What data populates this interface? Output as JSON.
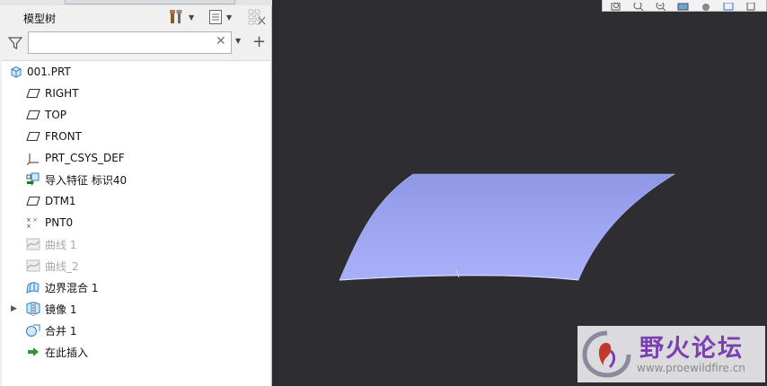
{
  "model_tree": {
    "title": "模型树",
    "search": {
      "value": "",
      "placeholder": ""
    },
    "items": [
      {
        "label": "001.PRT",
        "icon": "part-icon",
        "dim": false,
        "expandable": false,
        "indent": 0
      },
      {
        "label": "RIGHT",
        "icon": "datum-plane-icon",
        "dim": false,
        "expandable": false,
        "indent": 1
      },
      {
        "label": "TOP",
        "icon": "datum-plane-icon",
        "dim": false,
        "expandable": false,
        "indent": 1
      },
      {
        "label": "FRONT",
        "icon": "datum-plane-icon",
        "dim": false,
        "expandable": false,
        "indent": 1
      },
      {
        "label": "PRT_CSYS_DEF",
        "icon": "csys-icon",
        "dim": false,
        "expandable": false,
        "indent": 1
      },
      {
        "label": "导入特征 标识40",
        "icon": "import-feature-icon",
        "dim": false,
        "expandable": false,
        "indent": 1
      },
      {
        "label": "DTM1",
        "icon": "datum-plane-icon",
        "dim": false,
        "expandable": false,
        "indent": 1
      },
      {
        "label": "PNT0",
        "icon": "datum-point-icon",
        "dim": false,
        "expandable": false,
        "indent": 1
      },
      {
        "label": "曲线 1",
        "icon": "curve-icon",
        "dim": true,
        "expandable": false,
        "indent": 1
      },
      {
        "label": "曲线_2",
        "icon": "curve-icon",
        "dim": true,
        "expandable": false,
        "indent": 1
      },
      {
        "label": "边界混合 1",
        "icon": "boundary-blend-icon",
        "dim": false,
        "expandable": false,
        "indent": 1
      },
      {
        "label": "镜像 1",
        "icon": "mirror-icon",
        "dim": false,
        "expandable": true,
        "indent": 1
      },
      {
        "label": "合并 1",
        "icon": "merge-icon",
        "dim": false,
        "expandable": false,
        "indent": 1
      },
      {
        "label": "在此插入",
        "icon": "insert-here-icon",
        "dim": false,
        "expandable": false,
        "indent": 1
      }
    ]
  },
  "colors": {
    "viewport_bg": "#2d2d32",
    "surface": "#9aa3f0",
    "insert_arrow": "#2e9a2e",
    "watermark_text": "#7b3fb0"
  },
  "watermark": {
    "title": "野火论坛",
    "url": "www.proewildfire.cn"
  }
}
